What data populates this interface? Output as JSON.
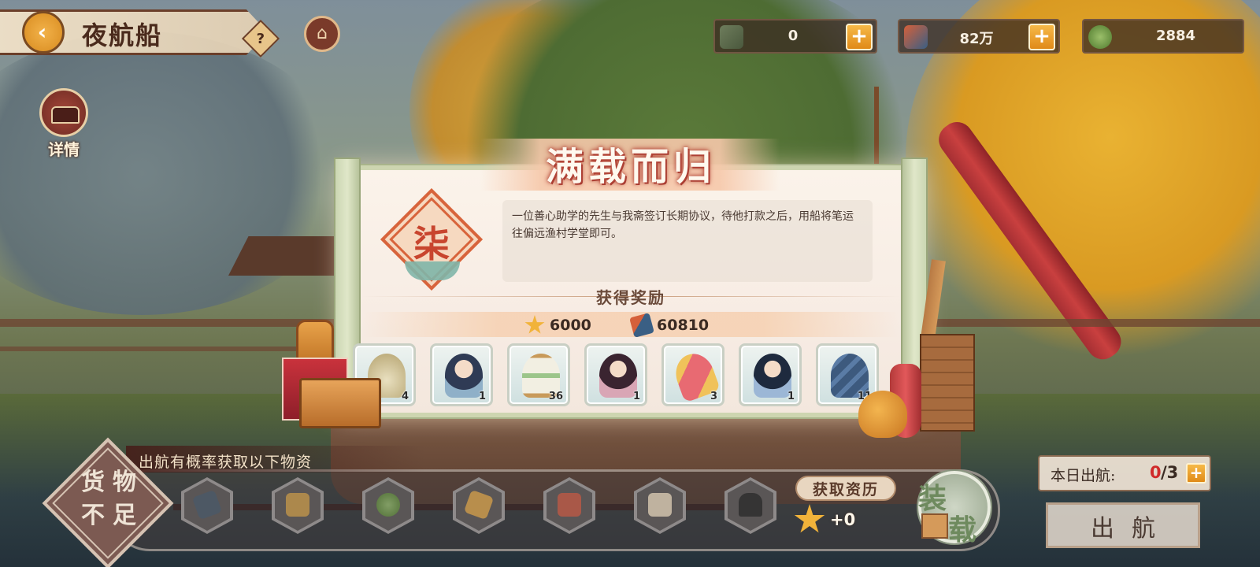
{
  "header": {
    "title": "夜航船",
    "back_icon": "‹",
    "help_icon": "?",
    "home_icon": "⌂"
  },
  "currencies": [
    {
      "name": "ticket",
      "value": "0",
      "add": "+"
    },
    {
      "name": "brush",
      "value": "82万",
      "add": "+"
    },
    {
      "name": "coin",
      "value": "2884"
    }
  ],
  "details": {
    "label": "详情"
  },
  "modal": {
    "title": "满载而归",
    "seal_char": "柒",
    "description": "一位善心助学的先生与我斋签订长期协议，待他打款之后，用船将笔运往偏远渔村学堂即可。",
    "reward_heading": "获得奖励",
    "main_rewards": [
      {
        "icon": "star-icon",
        "value": "6000"
      },
      {
        "icon": "brush-box-icon",
        "value": "60810"
      }
    ],
    "items": [
      {
        "icon": "pouch-icon",
        "count": "4"
      },
      {
        "icon": "scholar-portrait-icon",
        "count": "1"
      },
      {
        "icon": "hourglass-icon",
        "count": "36"
      },
      {
        "icon": "lady-portrait-icon",
        "count": "1"
      },
      {
        "icon": "scroll-icon",
        "count": "3"
      },
      {
        "icon": "swordsman-portrait-icon",
        "count": "1"
      },
      {
        "icon": "logs-icon",
        "count": "11"
      }
    ]
  },
  "cargo": {
    "hint": "出航有概率获取以下物资",
    "status": "货物\n不足",
    "slots": [
      "cannon-icon",
      "cart-icon",
      "jade-coin-icon",
      "lantern-icon",
      "painting-icon",
      "teapot-icon",
      "urn-icon"
    ],
    "xp_label": "获取资历",
    "xp_value": "+0",
    "load_char_1": "装",
    "load_char_2": "载"
  },
  "sailing": {
    "label": "本日出航:",
    "used": "0",
    "max": "/3",
    "add": "+",
    "depart_label": "出航"
  },
  "colors": {
    "accent_orange": "#e08a18",
    "title_red": "#b4473a",
    "count_red": "#d02a2a"
  }
}
